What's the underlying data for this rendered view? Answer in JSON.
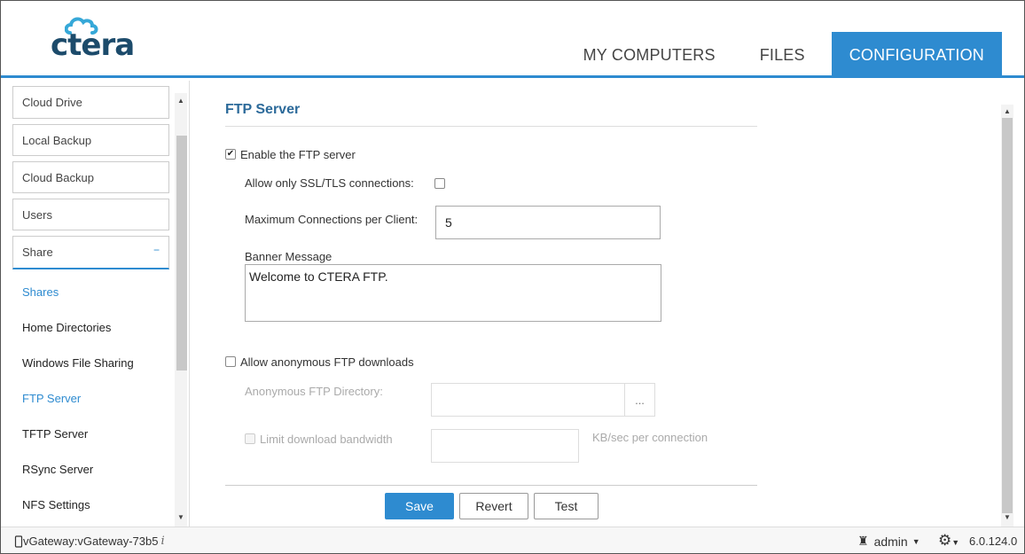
{
  "header": {
    "logo_text": "ctera",
    "nav": [
      {
        "label": "MY COMPUTERS",
        "active": false
      },
      {
        "label": "FILES",
        "active": false
      },
      {
        "label": "CONFIGURATION",
        "active": true
      }
    ],
    "accent": "#2e8bd0"
  },
  "sidebar": {
    "groups": [
      {
        "label": "Cloud Drive"
      },
      {
        "label": "Local Backup"
      },
      {
        "label": "Cloud Backup"
      },
      {
        "label": "Users"
      },
      {
        "label": "Share",
        "expand_symbol": "−"
      }
    ],
    "sub_items": [
      {
        "label": "Shares"
      },
      {
        "label": "Home Directories"
      },
      {
        "label": "Windows File Sharing"
      },
      {
        "label": "FTP Server"
      },
      {
        "label": "TFTP Server"
      },
      {
        "label": "RSync Server"
      },
      {
        "label": "NFS Settings"
      }
    ]
  },
  "main": {
    "title": "FTP Server",
    "enable_ftp": {
      "label": "Enable the FTP server",
      "checked": true
    },
    "ssl_only": {
      "label": "Allow only SSL/TLS connections:",
      "checked": false
    },
    "max_conn": {
      "label": "Maximum Connections per Client:",
      "value": "5"
    },
    "banner": {
      "label": "Banner Message",
      "value": "Welcome to CTERA FTP."
    },
    "anon": {
      "label": "Allow anonymous FTP downloads",
      "checked": false
    },
    "anon_dir": {
      "label": "Anonymous FTP Directory:",
      "value": "",
      "browse_label": "..."
    },
    "limit_bw": {
      "label": "Limit download bandwidth",
      "value": "",
      "unit": "KB/sec per connection"
    },
    "buttons": {
      "save": "Save",
      "revert": "Revert",
      "test": "Test"
    }
  },
  "footer": {
    "device": "vGateway:vGateway-73b5",
    "user": "admin",
    "version": "6.0.124.0"
  }
}
